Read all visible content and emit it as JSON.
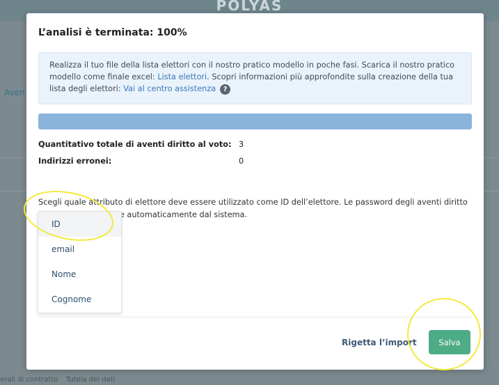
{
  "background": {
    "header_title": "POLYAS",
    "sidebar_tab": "Aven",
    "footer_links": [
      "erali di contratto",
      "Tutela dei dati"
    ]
  },
  "modal": {
    "title": "L’analisi è terminata: 100%",
    "info": {
      "text1": "Realizza il tuo file della lista elettori con il nostro pratico modello in poche fasi. Scarica il nostro pratico modello come finale excel: ",
      "link1": "Lista elettori",
      "text2": ". Scopri informazioni più approfondite sulla creazione della tua lista degli elettori: ",
      "link2": "Vai al centro assistenza",
      "help_icon_glyph": "?"
    },
    "progress": {
      "fraction": 1.0,
      "color": "#8ab4dc"
    },
    "stats": [
      {
        "label": "Quantitativo totale di aventi diritto al voto:",
        "value": "3"
      },
      {
        "label": "Indirizzi erronei:",
        "value": "0"
      }
    ],
    "instruction": "Scegli quale attributo di elettore deve essere utilizzato come ID dell’elettore. Le password degli aventi diritto al voto sono generate automaticamente dal sistema.",
    "dropdown": {
      "options": [
        "ID",
        "email",
        "Nome",
        "Cognome"
      ],
      "selected": "ID"
    },
    "buttons": {
      "reject_label": "Rigetta l’import",
      "save_label": "Salva"
    }
  },
  "colors": {
    "accent_green": "#4dab85",
    "link_blue": "#3a78b8",
    "highlight_yellow": "#f2e93b"
  }
}
